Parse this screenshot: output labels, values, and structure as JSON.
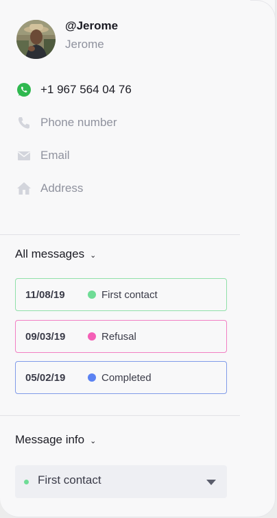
{
  "profile": {
    "handle": "@Jerome",
    "name": "Jerome"
  },
  "contact": {
    "whatsapp": {
      "icon": "whatsapp-icon",
      "value": "+1 967 564 04 76"
    },
    "phone": {
      "icon": "phone-icon",
      "placeholder": "Phone number"
    },
    "email": {
      "icon": "mail-icon",
      "placeholder": "Email"
    },
    "address": {
      "icon": "home-icon",
      "placeholder": "Address"
    }
  },
  "messages": {
    "title": "All messages",
    "items": [
      {
        "date": "11/08/19",
        "status": "First contact",
        "color": "#6fdc96",
        "border": "#8fe0a8"
      },
      {
        "date": "09/03/19",
        "status": "Refusal",
        "color": "#f45fb6",
        "border": "#f27ec3"
      },
      {
        "date": "05/02/19",
        "status": "Completed",
        "color": "#5b82f2",
        "border": "#7f9ae8"
      }
    ]
  },
  "message_info": {
    "title": "Message info",
    "selected": "First contact",
    "selected_color": "#6fdc96"
  },
  "colors": {
    "whatsapp": "#2fb84f",
    "icon_gray": "#d3d5dc"
  }
}
